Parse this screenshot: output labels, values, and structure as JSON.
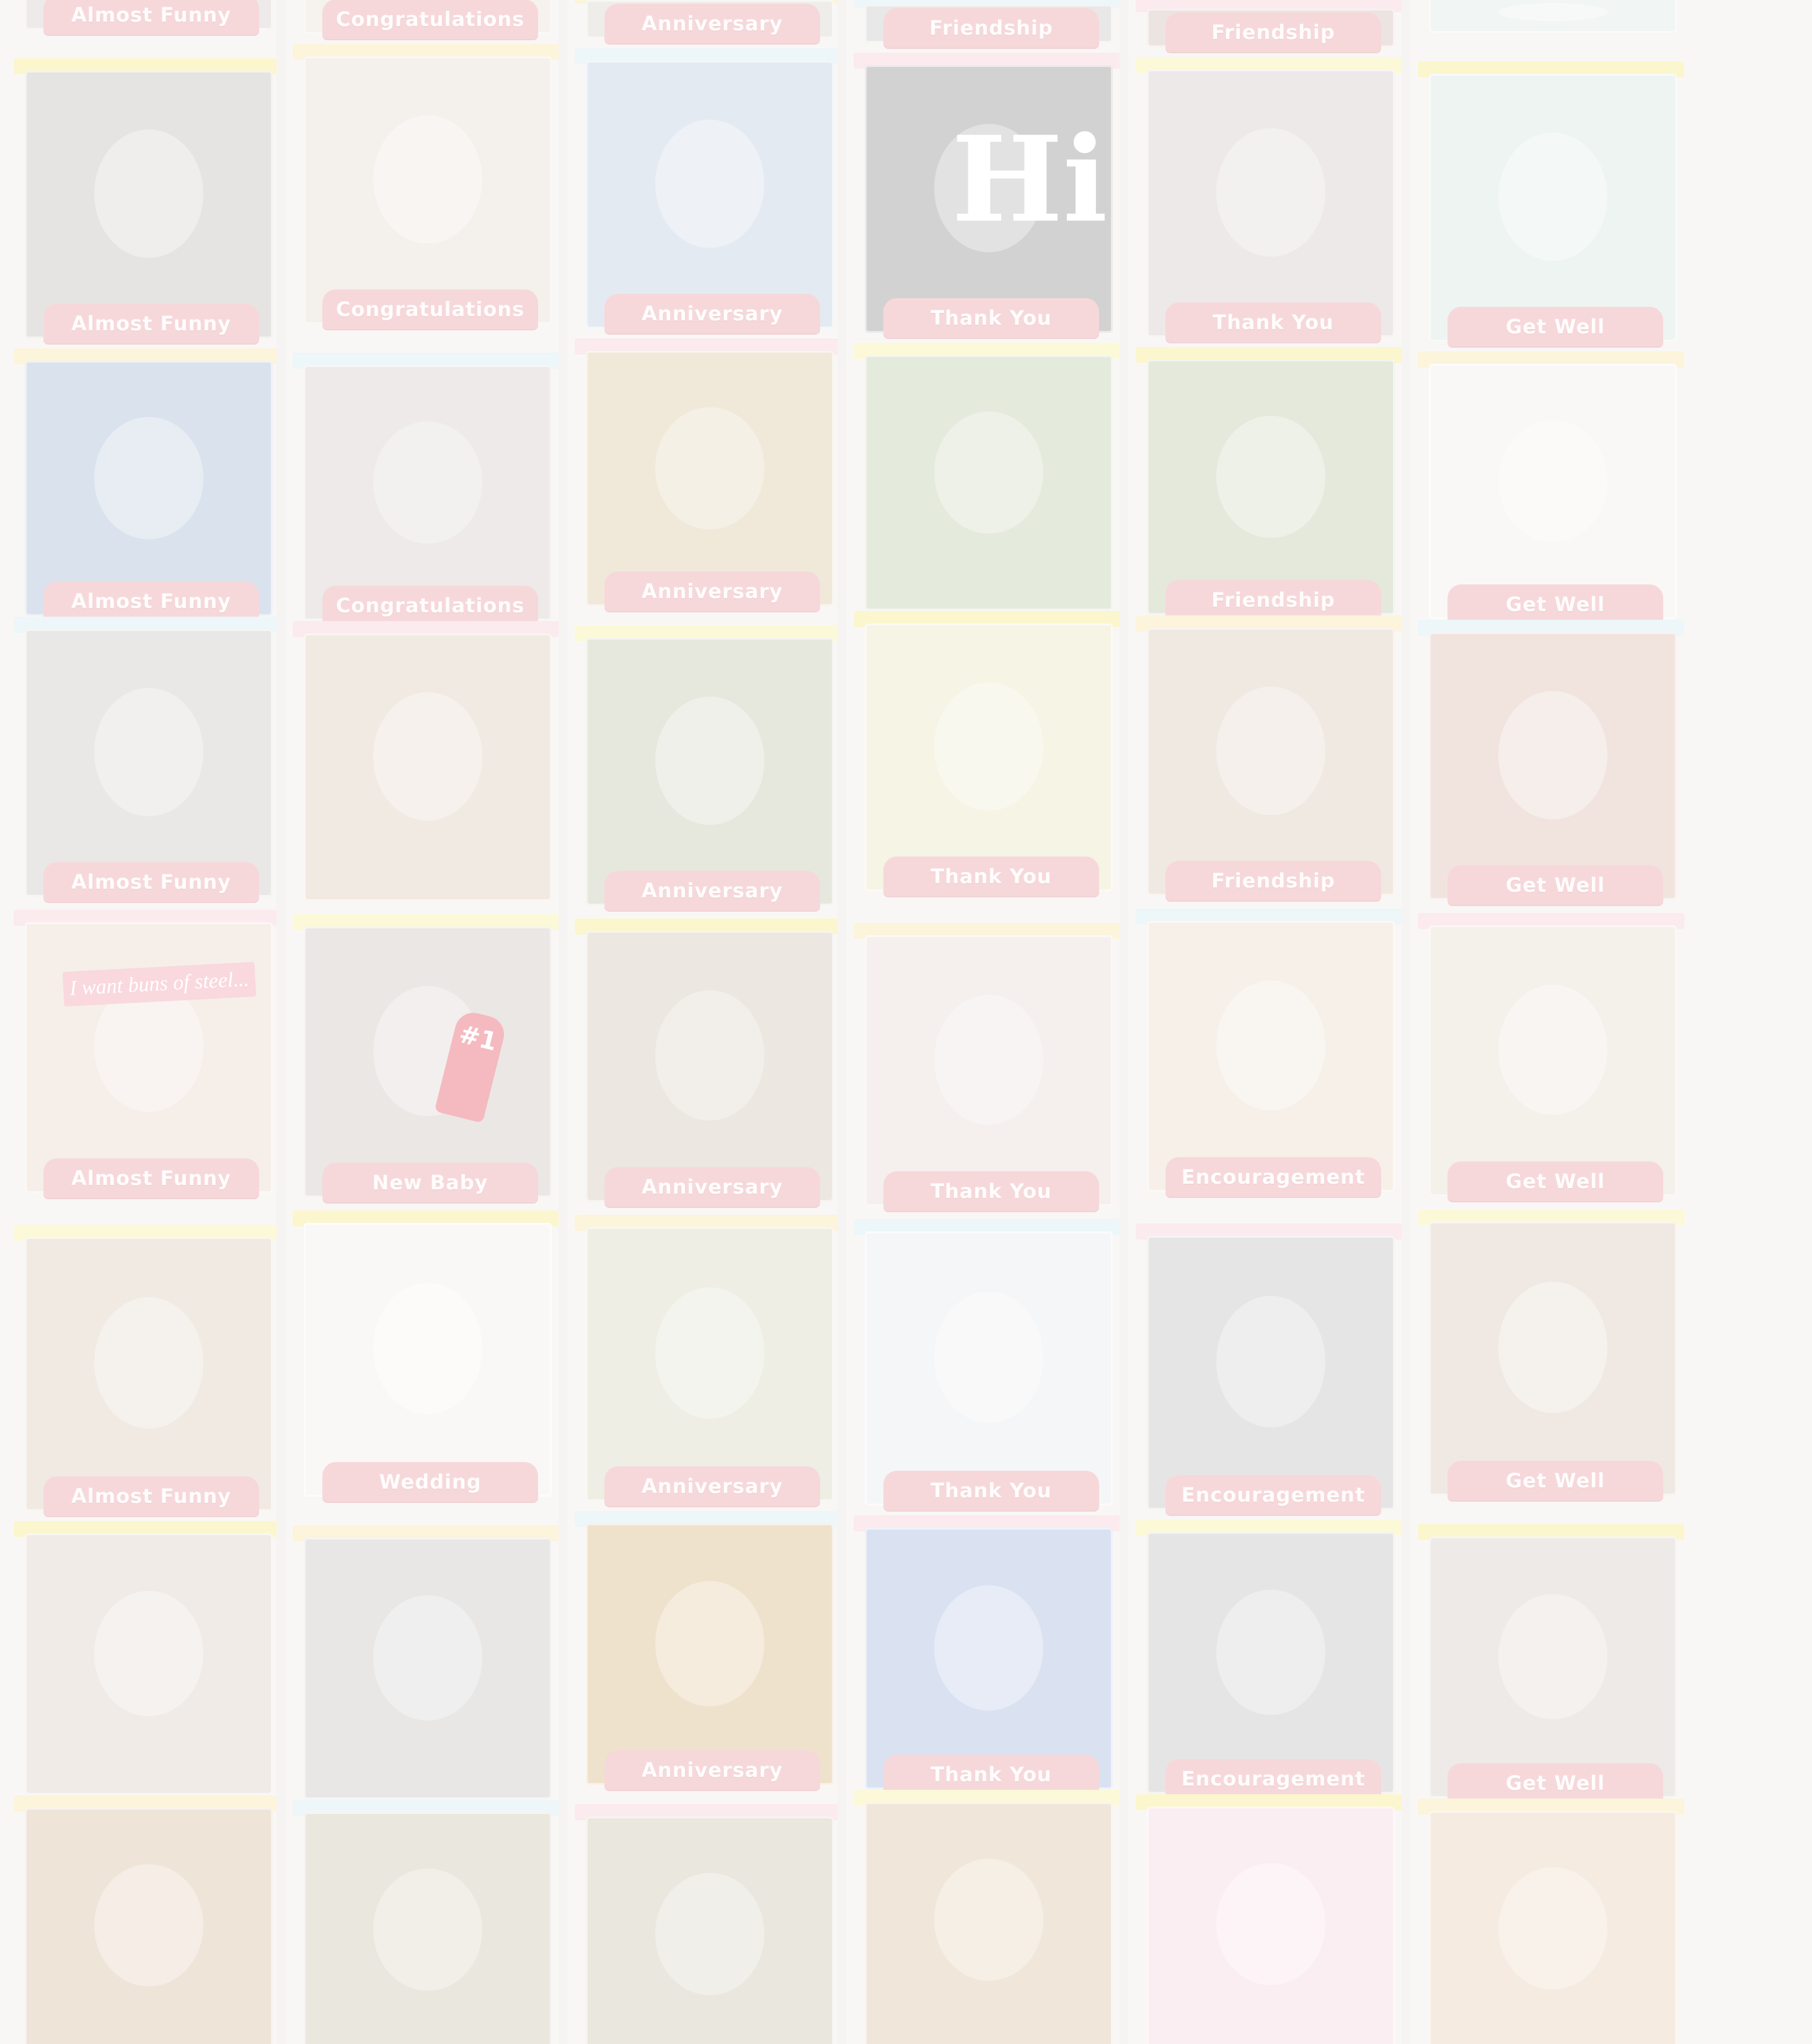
{
  "columns": [
    {
      "cards": [
        {
          "label": "Almost Funny",
          "color": "#cfc9c4"
        },
        {
          "label": "Almost Funny",
          "color": "#bdb8b6"
        },
        {
          "label": "Almost Funny",
          "color": "#9fb6cf"
        },
        {
          "label": "Almost Funny",
          "color": "#c9c3c0"
        },
        {
          "label": "Almost Funny",
          "color": "#e8d5c6",
          "caption": "I want buns of steel..."
        },
        {
          "label": "Almost Funny",
          "color": "#d8c7b5"
        },
        {
          "label": "",
          "color": "#d9cbc2"
        },
        {
          "label": "",
          "color": "#d6b79a"
        }
      ]
    },
    {
      "cards": [
        {
          "label": "Congratulations",
          "color": "#e6ddd2"
        },
        {
          "label": "Congratulations",
          "color": "#e2d7cb"
        },
        {
          "label": "Congratulations",
          "color": "#cfc8c4"
        },
        {
          "label": "",
          "color": "#dac8b2"
        },
        {
          "label": "New Baby",
          "color": "#c9bfb9",
          "badge": "#1"
        },
        {
          "label": "Wedding",
          "color": "#f1edea"
        },
        {
          "label": "",
          "color": "#c4c0be"
        },
        {
          "label": "",
          "color": "#c9c0a8"
        }
      ]
    },
    {
      "cards": [
        {
          "label": "Anniversary",
          "color": "#d3cfc6"
        },
        {
          "label": "Anniversary",
          "color": "#b8c8dc"
        },
        {
          "label": "Anniversary",
          "color": "#d7c49c"
        },
        {
          "label": "Anniversary",
          "color": "#bdc2a6"
        },
        {
          "label": "Anniversary",
          "color": "#cdbfae"
        },
        {
          "label": "Anniversary",
          "color": "#d2d2b8"
        },
        {
          "label": "Anniversary",
          "color": "#d6b27c"
        },
        {
          "label": "",
          "color": "#c8c0a8"
        }
      ]
    },
    {
      "cards": [
        {
          "label": "Friendship",
          "color": "#c6c3c2"
        },
        {
          "label": "Thank You",
          "color": "#8d8a89",
          "bigtext": "Hi"
        },
        {
          "label": "",
          "color": "#b9c7a4"
        },
        {
          "label": "Thank You",
          "color": "#e6e3b8"
        },
        {
          "label": "Thank You",
          "color": "#e4d4d2"
        },
        {
          "label": "Thank You",
          "color": "#e5e8ec"
        },
        {
          "label": "Thank You",
          "color": "#9fb3d9"
        },
        {
          "label": "",
          "color": "#d7bd9c"
        }
      ]
    },
    {
      "cards": [
        {
          "label": "Friendship",
          "color": "#cdb9b0"
        },
        {
          "label": "Thank You",
          "color": "#d0c6c2"
        },
        {
          "label": "Friendship",
          "color": "#b9c6a3"
        },
        {
          "label": "Friendship",
          "color": "#d8c4b0"
        },
        {
          "label": "Encouragement",
          "color": "#e8d8c6"
        },
        {
          "label": "Encouragement",
          "color": "#bebcbb"
        },
        {
          "label": "Encouragement",
          "color": "#bdbbbb"
        },
        {
          "label": "",
          "color": "#f3d3dc"
        }
      ]
    },
    {
      "cards": [
        {
          "label": "",
          "color": "#d9e7e1"
        },
        {
          "label": "Get Well",
          "color": "#d3e2dd"
        },
        {
          "label": "Get Well",
          "color": "#f1ece8"
        },
        {
          "label": "Get Well",
          "color": "#d9b8aa"
        },
        {
          "label": "Get Well",
          "color": "#e3d7c9"
        },
        {
          "label": "Get Well",
          "color": "#d7c5b5"
        },
        {
          "label": "Get Well",
          "color": "#d3c8c1"
        },
        {
          "label": "",
          "color": "#e5cbb0"
        }
      ]
    }
  ]
}
